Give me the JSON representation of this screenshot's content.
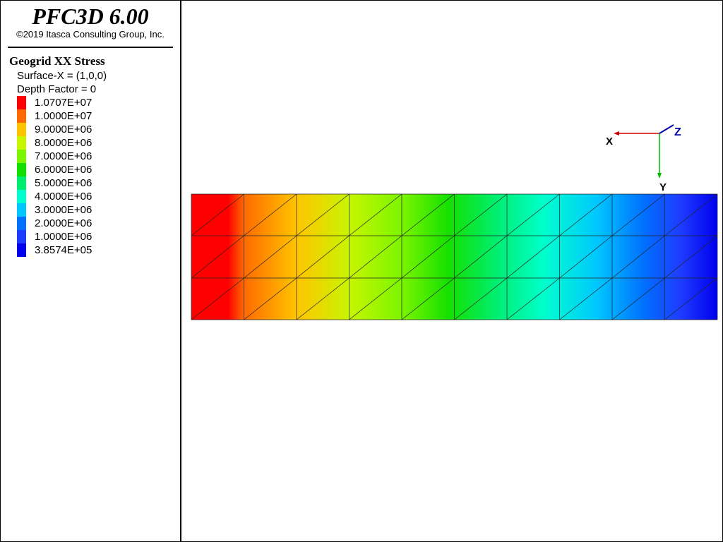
{
  "header": {
    "app_title": "PFC3D 6.00",
    "copyright": "©2019 Itasca Consulting Group, Inc."
  },
  "legend": {
    "title": "Geogrid XX Stress",
    "surface_label": "Surface-X = (1,0,0)",
    "depth_label": "Depth Factor = 0",
    "items": [
      {
        "label": "1.0707E+07",
        "color": "#ff0000"
      },
      {
        "label": "1.0000E+07",
        "color": "#ff6a00"
      },
      {
        "label": "9.0000E+06",
        "color": "#ffc400"
      },
      {
        "label": "8.0000E+06",
        "color": "#c8f500"
      },
      {
        "label": "7.0000E+06",
        "color": "#7cf500"
      },
      {
        "label": "6.0000E+06",
        "color": "#14e000"
      },
      {
        "label": "5.0000E+06",
        "color": "#00ee70"
      },
      {
        "label": "4.0000E+06",
        "color": "#00ffcc"
      },
      {
        "label": "3.0000E+06",
        "color": "#00c8ff"
      },
      {
        "label": "2.0000E+06",
        "color": "#0070ff"
      },
      {
        "label": "1.0000E+06",
        "color": "#1e3cff"
      },
      {
        "label": "3.8574E+05",
        "color": "#0000ee"
      }
    ]
  },
  "axes": {
    "x_label": "X",
    "y_label": "Y",
    "z_label": "Z",
    "x_color": "#cc0000",
    "y_color": "#00bb00",
    "z_color": "#0000aa"
  }
}
